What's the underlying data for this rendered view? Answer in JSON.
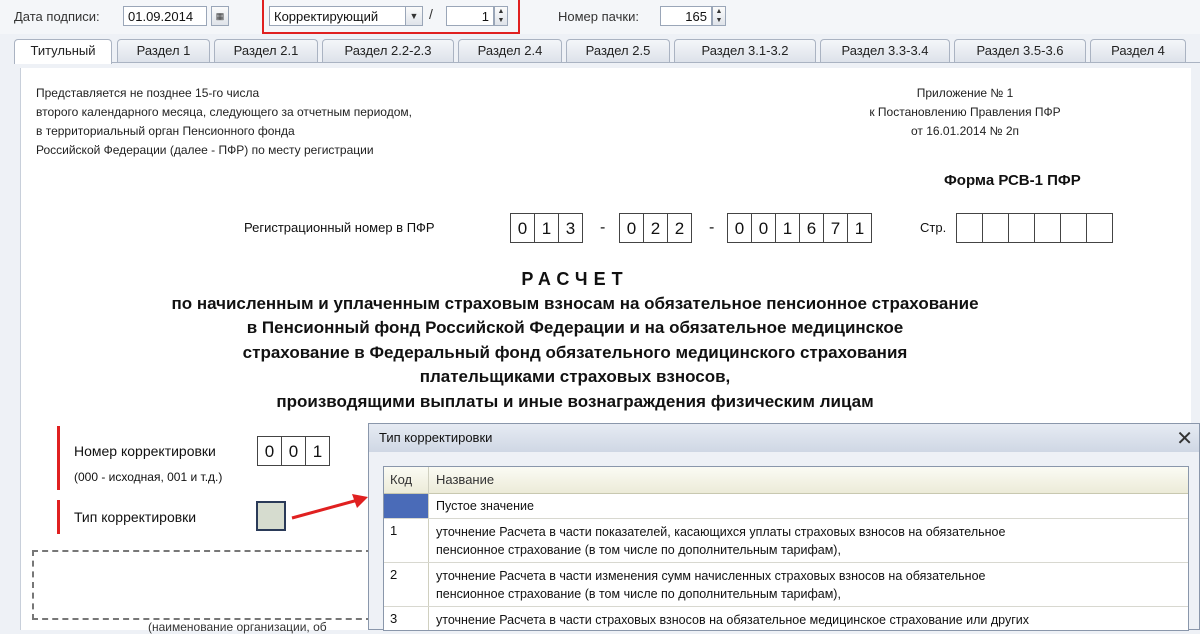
{
  "toolbar": {
    "date_label": "Дата подписи:",
    "date_value": "01.09.2014",
    "correction_type": "Корректирующий",
    "slash": "/",
    "correction_number": "1",
    "pack_label": "Номер пачки:",
    "pack_value": "165"
  },
  "tabs": [
    "Титульный",
    "Раздел 1",
    "Раздел 2.1",
    "Раздел 2.2-2.3",
    "Раздел 2.4",
    "Раздел 2.5",
    "Раздел 3.1-3.2",
    "Раздел 3.3-3.4",
    "Раздел 3.5-3.6",
    "Раздел 4"
  ],
  "form": {
    "left_note": [
      "Представляется не позднее 15-го числа",
      "второго календарного месяца, следующего за отчетным периодом,",
      "в территориальный орган Пенсионного фонда",
      "Российской Федерации (далее - ПФР) по месту регистрации"
    ],
    "appendix": [
      "Приложение № 1",
      "к Постановлению Правления ПФР",
      "от 16.01.2014 № 2п"
    ],
    "form_name": "Форма РСВ-1 ПФР",
    "reg_label": "Регистрационный номер в ПФР",
    "reg_part1": [
      "0",
      "1",
      "3"
    ],
    "reg_part2": [
      "0",
      "2",
      "2"
    ],
    "reg_part3": [
      "0",
      "0",
      "1",
      "6",
      "7",
      "1"
    ],
    "page_label": "Стр.",
    "title_main": "РАСЧЕТ",
    "title_lines": [
      "по начисленным и уплаченным страховым взносам на обязательное пенсионное страхование",
      "в Пенсионный фонд Российской Федерации и на обязательное медицинское",
      "страхование в Федеральный фонд обязательного медицинского страхования",
      "плательщиками страховых взносов,",
      "производящими выплаты и иные вознаграждения физическим лицам"
    ],
    "corr_number_label": "Номер корректировки",
    "corr_number_cells": [
      "0",
      "0",
      "1"
    ],
    "corr_hint": "(000 - исходная, 001 и т.д.)",
    "corr_type_label": "Тип корректировки",
    "org_caption": "(наименование организации, об"
  },
  "dialog": {
    "title": "Тип корректировки",
    "close": "✕",
    "col_code": "Код",
    "col_name": "Название",
    "rows": [
      {
        "code": "",
        "name": "Пустое значение"
      },
      {
        "code": "1",
        "name": "уточнение Расчета в части показателей, касающихся  уплаты страховых взносов на обязательное\nпенсионное страхование (в том числе по дополнительным тарифам),"
      },
      {
        "code": "2",
        "name": "уточнение Расчета в части изменения сумм начисленных страховых взносов на обязательное\nпенсионное страхование (в том числе по дополнительным тарифам),"
      },
      {
        "code": "3",
        "name": "уточнение Расчета в части страховых взносов на обязательное медицинское страхование или других"
      }
    ]
  },
  "colors": {
    "highlight_red": "#e02020",
    "selected_row": "#4a6bb8"
  }
}
